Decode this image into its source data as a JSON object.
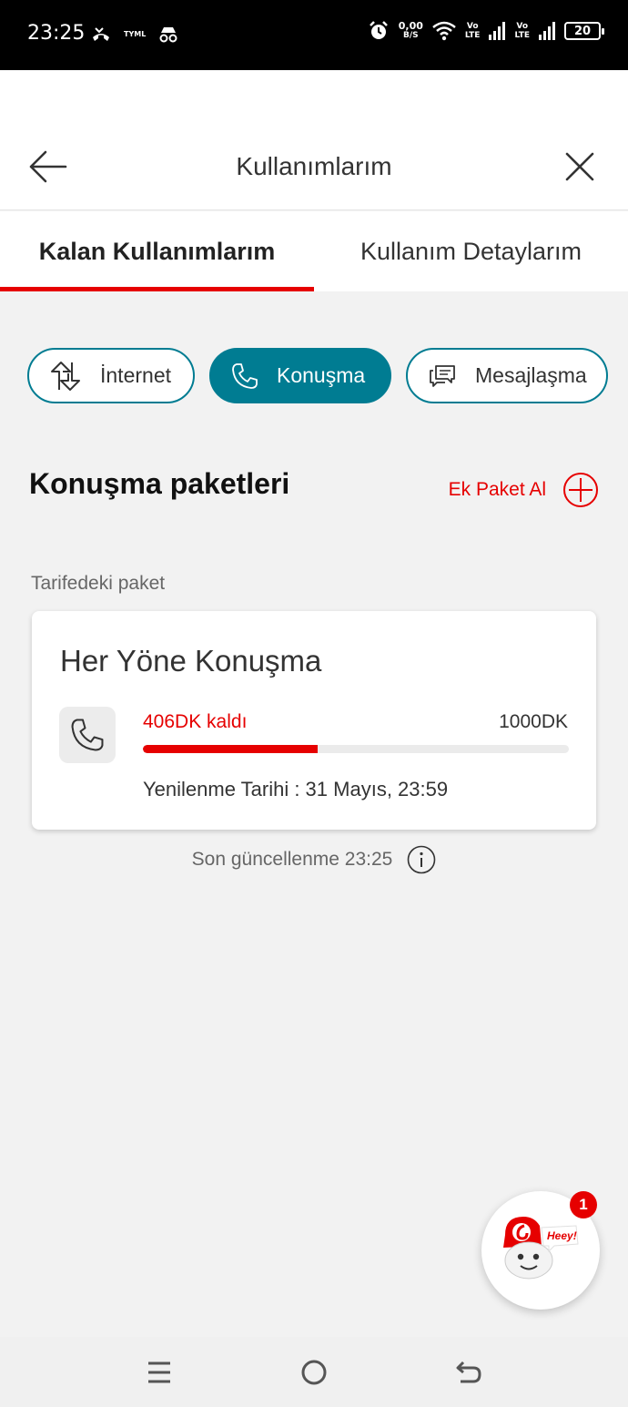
{
  "status_bar": {
    "time": "23:25",
    "tyml_label": "TYML",
    "speed_value": "0,00",
    "speed_unit": "B/S",
    "vo_1": "Vo",
    "lte_1": "LTE",
    "vo_2": "Vo",
    "lte_2": "LTE",
    "battery": "20"
  },
  "header": {
    "title": "Kullanımlarım"
  },
  "tabs": [
    {
      "label": "Kalan Kullanımlarım",
      "active": true
    },
    {
      "label": "Kullanım Detaylarım",
      "active": false
    }
  ],
  "chips": [
    {
      "label": "İnternet",
      "icon": "data-arrows-icon",
      "active": false
    },
    {
      "label": "Konuşma",
      "icon": "phone-icon",
      "active": true
    },
    {
      "label": "Mesajlaşma",
      "icon": "chat-icon",
      "active": false
    }
  ],
  "section": {
    "title": "Konuşma paketleri",
    "add_label": "Ek Paket Al",
    "sub_label": "Tarifedeki paket"
  },
  "package": {
    "name": "Her Yöne Konuşma",
    "remaining_label": "406DK kaldı",
    "total_label": "1000DK",
    "remaining": 406,
    "total": 1000,
    "used_fraction": 0.41,
    "renewal": "Yenilenme Tarihi : 31 Mayıs, 23:59"
  },
  "last_update": "Son güncellenme 23:25",
  "assistant": {
    "badge_count": "1",
    "bubble_text": "Heey!"
  },
  "colors": {
    "accent_red": "#e60000",
    "teal": "#007c92"
  }
}
